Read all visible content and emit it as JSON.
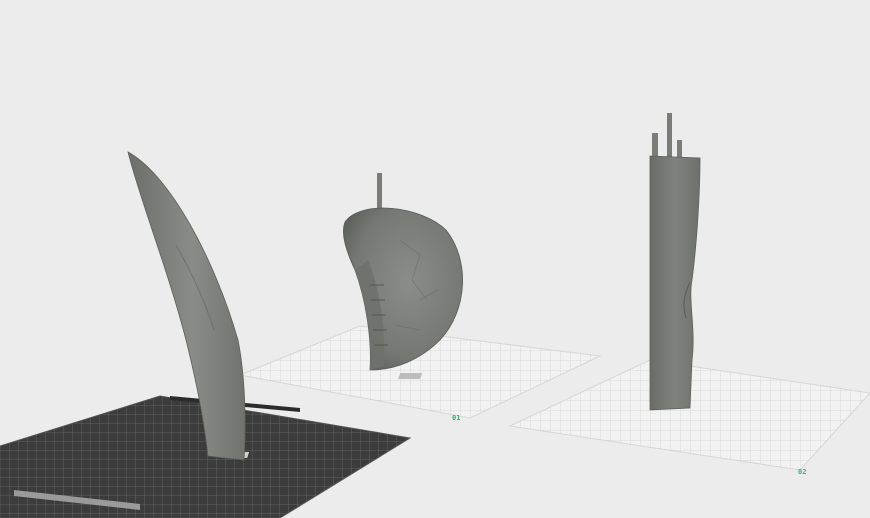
{
  "viewport": {
    "background_color": "#ececec",
    "model_color": "#7d7f7a",
    "model_shadow_color": "#5e605b",
    "grid_color": "#c8c8c8",
    "dark_plate_color": "#3a3a3a",
    "plate_label_color": "#2fb36b"
  },
  "plates": [
    {
      "id": "plate-front-left",
      "label": "",
      "style": "dark"
    },
    {
      "id": "plate-middle",
      "label": "01",
      "style": "light"
    },
    {
      "id": "plate-right",
      "label": "02",
      "style": "light"
    }
  ],
  "models": [
    {
      "id": "model-curved-blade",
      "shape": "curved-blade"
    },
    {
      "id": "model-shell-half",
      "shape": "shell-half"
    },
    {
      "id": "model-column",
      "shape": "column"
    }
  ]
}
